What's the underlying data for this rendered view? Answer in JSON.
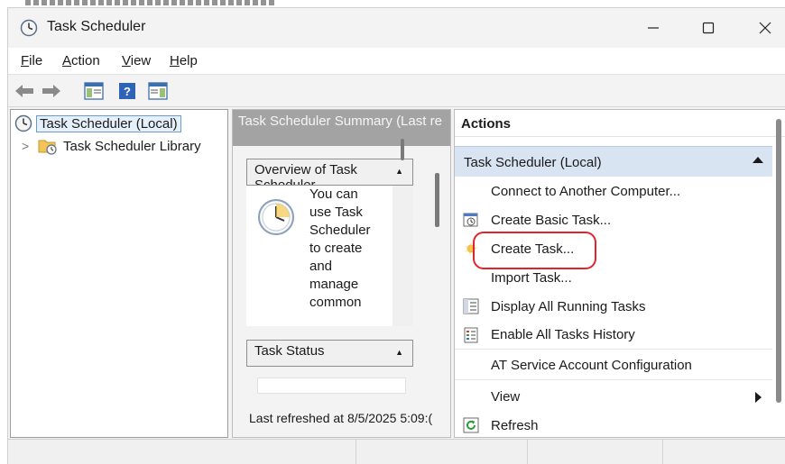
{
  "window": {
    "title": "Task Scheduler",
    "icon": "clock-icon",
    "controls": {
      "minimize": "—",
      "maximize": "☐",
      "close": "✕"
    }
  },
  "menu": {
    "items": [
      {
        "mnemonic": "F",
        "rest": "ile"
      },
      {
        "mnemonic": "A",
        "rest": "ction"
      },
      {
        "mnemonic": "V",
        "rest": "iew"
      },
      {
        "mnemonic": "H",
        "rest": "elp"
      }
    ]
  },
  "toolbar": {
    "buttons": [
      "back-arrow-icon",
      "forward-arrow-icon",
      "show-hide-console-tree-icon",
      "help-icon",
      "show-hide-action-pane-icon"
    ]
  },
  "tree": {
    "items": [
      {
        "label": "Task Scheduler (Local)",
        "icon": "clock-icon",
        "selected": true
      },
      {
        "label": "Task Scheduler Library",
        "icon": "folder-clock-icon",
        "expander": ">"
      }
    ]
  },
  "center": {
    "header": "Task Scheduler Summary (Last re",
    "overview": {
      "title": "Overview of Task Scheduler",
      "text": [
        "You can",
        "use Task",
        "Scheduler",
        "to create",
        "and",
        "manage",
        "common"
      ]
    },
    "status_box": {
      "title": "Task Status"
    },
    "last_refreshed": "Last refreshed at 8/5/2025 5:09:("
  },
  "actions": {
    "title": "Actions",
    "group": "Task Scheduler (Local)",
    "items": [
      {
        "label": "Connect to Another Computer...",
        "icon": ""
      },
      {
        "label": "Create Basic Task...",
        "icon": "create-basic-task-icon"
      },
      {
        "label": "Create Task...",
        "icon": "create-task-icon"
      },
      {
        "label": "Import Task...",
        "icon": ""
      },
      {
        "label": "Display All Running Tasks",
        "icon": "running-tasks-icon"
      },
      {
        "label": "Enable All Tasks History",
        "icon": "tasks-history-icon"
      },
      {
        "label": "AT Service Account Configuration",
        "icon": ""
      },
      {
        "label": "View",
        "icon": "",
        "submenu": true
      },
      {
        "label": "Refresh",
        "icon": "refresh-icon"
      }
    ],
    "highlighted_item": "Create Task..."
  },
  "colors": {
    "highlight_ring": "#e0242c",
    "selection_border": "#6b9bd4",
    "actions_group_bg": "#d9e4f2",
    "center_header_bg": "#a3a3a3"
  }
}
